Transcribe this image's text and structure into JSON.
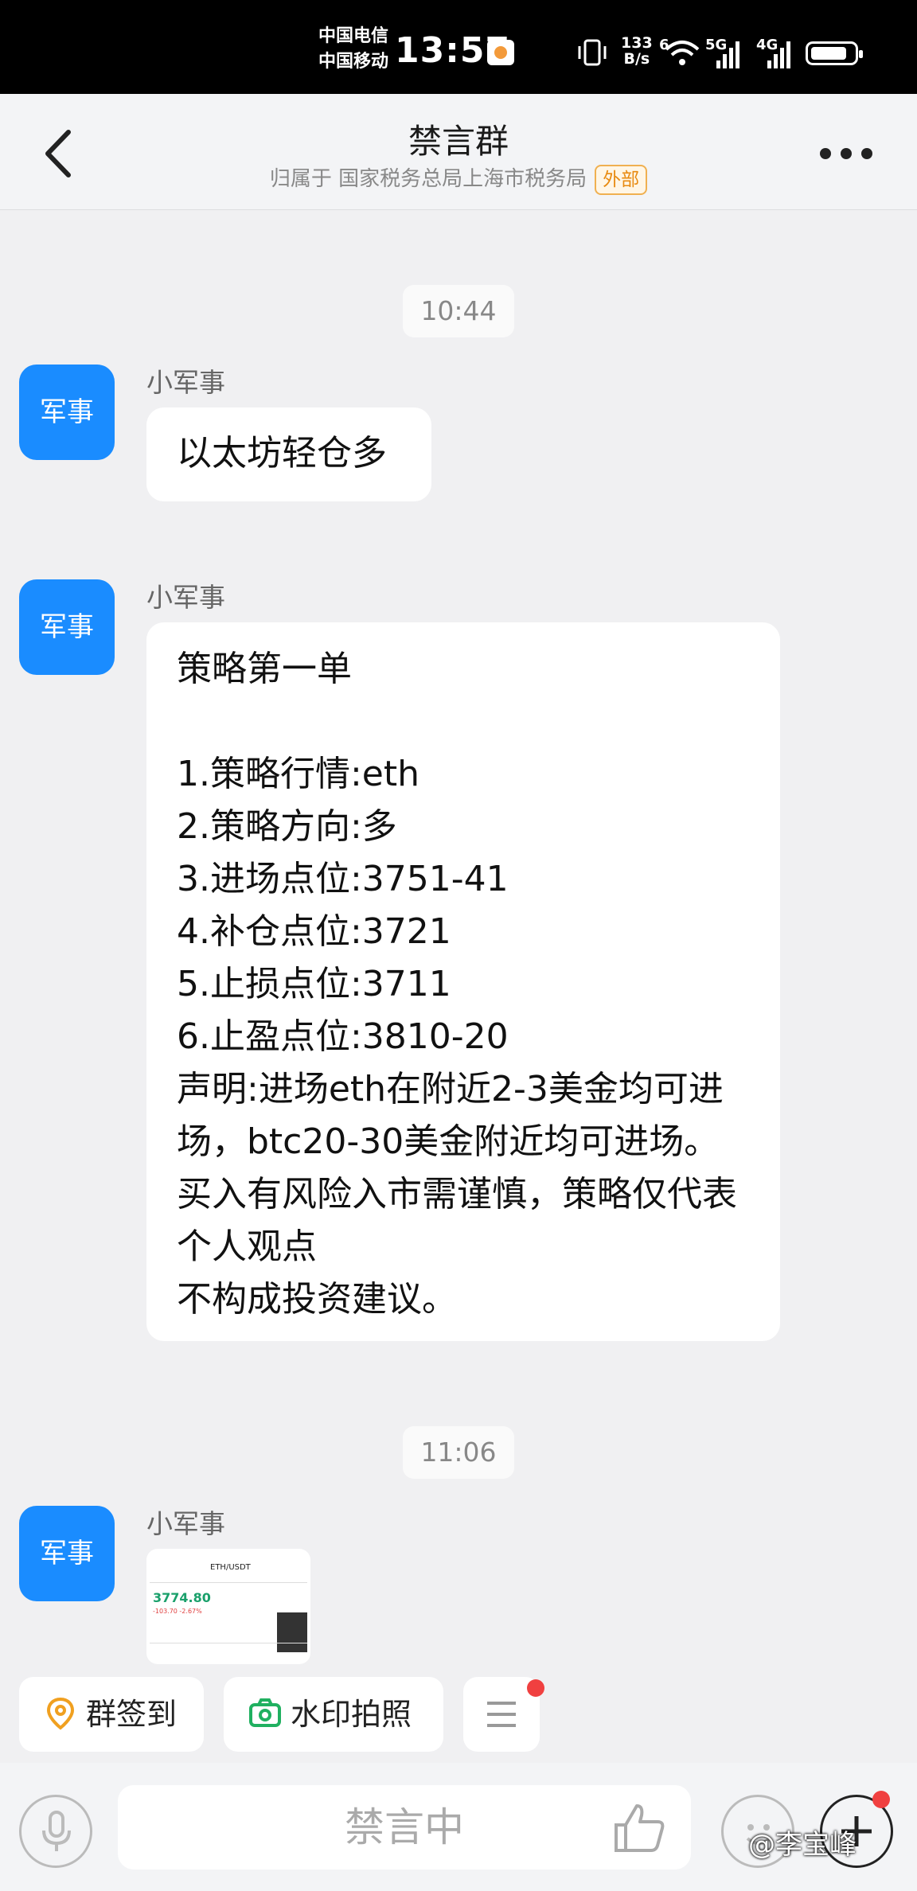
{
  "status_bar": {
    "carrier1": "中国电信",
    "carrier2": "中国移动",
    "time": "13:57",
    "speed_value": "133",
    "speed_unit": "B/s",
    "wifi_label": "6",
    "net1": "5G",
    "net2": "4G"
  },
  "header": {
    "title": "禁言群",
    "subtitle": "归属于 国家税务总局上海市税务局",
    "tag": "外部"
  },
  "messages": [
    {
      "time": "10:44",
      "avatar_text": "军事",
      "sender": "小军事",
      "text": "以太坊轻仓多"
    },
    {
      "avatar_text": "军事",
      "sender": "小军事",
      "text": "策略第一单\n\n1.策略行情:eth\n2.策略方向:多\n3.进场点位:3751-41\n4.补仓点位:3721\n5.止损点位:3711\n6.止盈点位:3810-20\n声明:进场eth在附近2-3美金均可进场，btc20-30美金附近均可进场。买入有风险入市需谨慎，策略仅代表个人观点\n不构成投资建议。"
    },
    {
      "time": "11:06",
      "avatar_text": "军事",
      "sender": "小军事",
      "image": {
        "pair": "ETH/USDT",
        "price": "3774.80",
        "change": "-103.70 -2.67%"
      }
    }
  ],
  "quick_actions": [
    {
      "label": "群签到",
      "icon": "location-pin-icon"
    },
    {
      "label": "水印拍照",
      "icon": "camera-icon"
    },
    {
      "icon": "menu-icon"
    }
  ],
  "input": {
    "placeholder": "禁言中"
  },
  "watermark": "@李宝峰"
}
